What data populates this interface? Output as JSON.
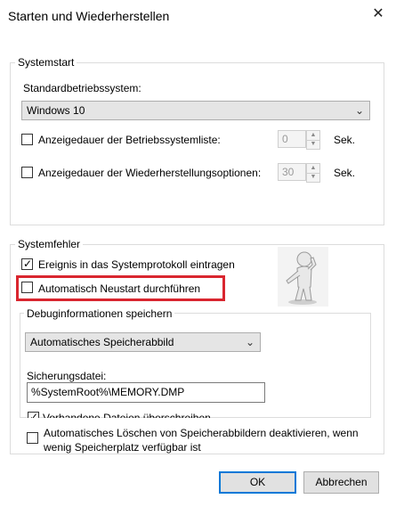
{
  "window": {
    "title": "Starten und Wiederherstellen",
    "close_glyph": "✕"
  },
  "systemstart": {
    "legend": "Systemstart",
    "default_os_label": "Standardbetriebssystem:",
    "default_os_value": "Windows 10",
    "os_list_label": "Anzeigedauer der Betriebssystemliste:",
    "os_list_checked": false,
    "os_list_value": "0",
    "recovery_label": "Anzeigedauer der Wiederherstellungsoptionen:",
    "recovery_checked": false,
    "recovery_value": "30",
    "unit": "Sek."
  },
  "systemfehler": {
    "legend": "Systemfehler",
    "log_event_label": "Ereignis in das Systemprotokoll eintragen",
    "log_event_checked": true,
    "auto_restart_label": "Automatisch Neustart durchführen",
    "auto_restart_checked": false,
    "debug": {
      "legend": "Debuginformationen speichern",
      "dump_type_value": "Automatisches Speicherabbild",
      "dump_file_label": "Sicherungsdatei:",
      "dump_file_value": "%SystemRoot%\\MEMORY.DMP",
      "overwrite_label": "Vorhandene Dateien überschreiben",
      "overwrite_checked": true
    },
    "auto_delete_label_line1": "Automatisches Löschen von Speicherabbildern deaktivieren, wenn",
    "auto_delete_label_line2": "wenig Speicherplatz verfügbar ist",
    "auto_delete_checked": false
  },
  "buttons": {
    "ok": "OK",
    "cancel": "Abbrechen"
  },
  "colors": {
    "highlight": "#d9262f",
    "accent": "#0078d7"
  },
  "icons": {
    "close": "close-icon",
    "chevron": "chevron-down-icon",
    "figure": "thinking-figure-illustration"
  }
}
